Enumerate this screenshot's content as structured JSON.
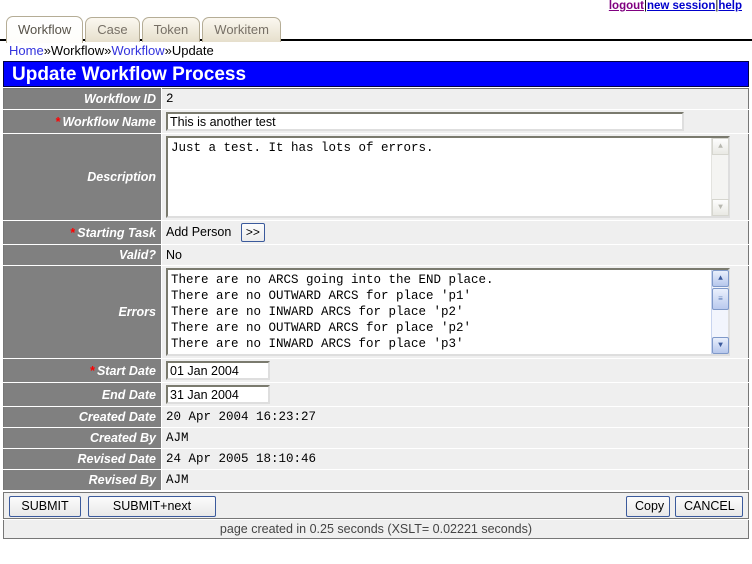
{
  "toplinks": {
    "logout": "logout",
    "new_session": "new session",
    "help": "help",
    "separator": "|"
  },
  "tabs": [
    {
      "label": "Workflow",
      "active": true
    },
    {
      "label": "Case",
      "active": false
    },
    {
      "label": "Token",
      "active": false
    },
    {
      "label": "Workitem",
      "active": false
    }
  ],
  "breadcrumb": {
    "home": "Home",
    "sep1": "»",
    "crumb2": "Workflow",
    "sep2": "»",
    "crumb3": "Workflow",
    "sep3": "»",
    "crumb4": "Update"
  },
  "banner": {
    "title": "Update Workflow Process"
  },
  "form": {
    "workflow_id": {
      "label": "Workflow ID",
      "value": "2",
      "required": false
    },
    "workflow_name": {
      "label": "Workflow Name",
      "value": "This is another test",
      "required": true
    },
    "description": {
      "label": "Description",
      "value": "Just a test. It has lots of errors.",
      "required": false
    },
    "starting_task": {
      "label": "Starting Task",
      "value": "Add Person",
      "button": "»",
      "button_text": ">>",
      "required": true
    },
    "valid": {
      "label": "Valid?",
      "value": "No",
      "required": false
    },
    "errors": {
      "label": "Errors",
      "value": "There are no ARCS going into the END place.\nThere are no OUTWARD ARCS for place 'p1'\nThere are no INWARD ARCS for place 'p2'\nThere are no OUTWARD ARCS for place 'p2'\nThere are no INWARD ARCS for place 'p3'",
      "required": false
    },
    "start_date": {
      "label": "Start Date",
      "value": "01 Jan 2004",
      "required": true
    },
    "end_date": {
      "label": "End Date",
      "value": "31 Jan 2004",
      "required": false
    },
    "created_date": {
      "label": "Created Date",
      "value": "20 Apr 2004 16:23:27",
      "required": false
    },
    "created_by": {
      "label": "Created By",
      "value": "AJM",
      "required": false
    },
    "revised_date": {
      "label": "Revised Date",
      "value": "24 Apr 2005 18:10:46",
      "required": false
    },
    "revised_by": {
      "label": "Revised By",
      "value": "AJM",
      "required": false
    },
    "required_marker": "*"
  },
  "buttons": {
    "submit": "SUBMIT",
    "submit_next": "SUBMIT+next",
    "copy": "Copy",
    "cancel": "CANCEL"
  },
  "footer": {
    "text": "page created in 0.25 seconds (XSLT= 0.02221 seconds)"
  },
  "colors": {
    "banner_bg": "#0000ff",
    "label_bg": "#808080",
    "required": "#ff0000",
    "link": "#3333dd",
    "visited_link": "#800080",
    "page_bg": "#efefef"
  },
  "scrollbar_icons": {
    "up": "▲",
    "down": "▼",
    "grip": "≡"
  }
}
